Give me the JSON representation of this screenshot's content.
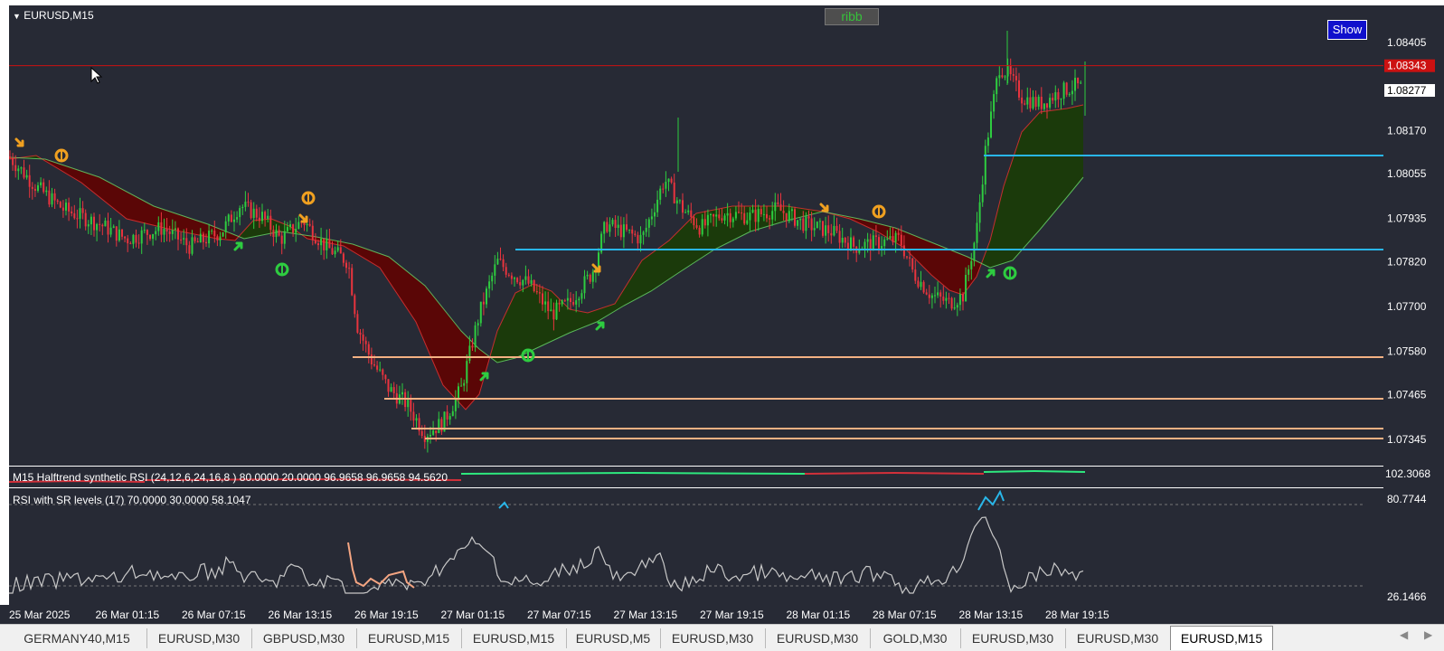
{
  "chart": {
    "title": "EURUSD,M15",
    "ribbon_button": "ribb",
    "show_button": "Show",
    "price_ticks": [
      "1.08405",
      "1.08170",
      "1.08055",
      "1.07935",
      "1.07820",
      "1.07700",
      "1.07580",
      "1.07465",
      "1.07345"
    ],
    "bid_label": "1.08343",
    "current_label": "1.08277",
    "time_ticks": [
      "25 Mar 2025",
      "26 Mar 01:15",
      "26 Mar 07:15",
      "26 Mar 13:15",
      "26 Mar 19:15",
      "27 Mar 01:15",
      "27 Mar 07:15",
      "27 Mar 13:15",
      "27 Mar 19:15",
      "28 Mar 01:15",
      "28 Mar 07:15",
      "28 Mar 13:15",
      "28 Mar 19:15"
    ],
    "colors": {
      "background": "#272a35",
      "bid_line": "#cc1111",
      "support": "#f4b183",
      "resistance": "#29b6e8",
      "bull_ribbon": "#1b3a0b",
      "bear_ribbon": "#5a0606"
    }
  },
  "indicator1": {
    "title": "M15 Halftrend synthetic RSI  (24,12,6,24,16,8 ) 80.0000 20.0000 96.9658 96.9658 94.5620",
    "axis_label": "102.3068"
  },
  "indicator2": {
    "title": "RSI with SR levels (17) 70.0000 30.0000 58.1047",
    "axis_top": "80.7744",
    "axis_bottom": "26.1466"
  },
  "tabs": [
    "GERMANY40,M15",
    "EURUSD,M30",
    "GBPUSD,M30",
    "EURUSD,M15",
    "EURUSD,M15",
    "EURUSD,M5",
    "EURUSD,M30",
    "EURUSD,M30",
    "GOLD,M30",
    "EURUSD,M30",
    "EURUSD,M30",
    "EURUSD,M15"
  ],
  "active_tab_index": 11
}
